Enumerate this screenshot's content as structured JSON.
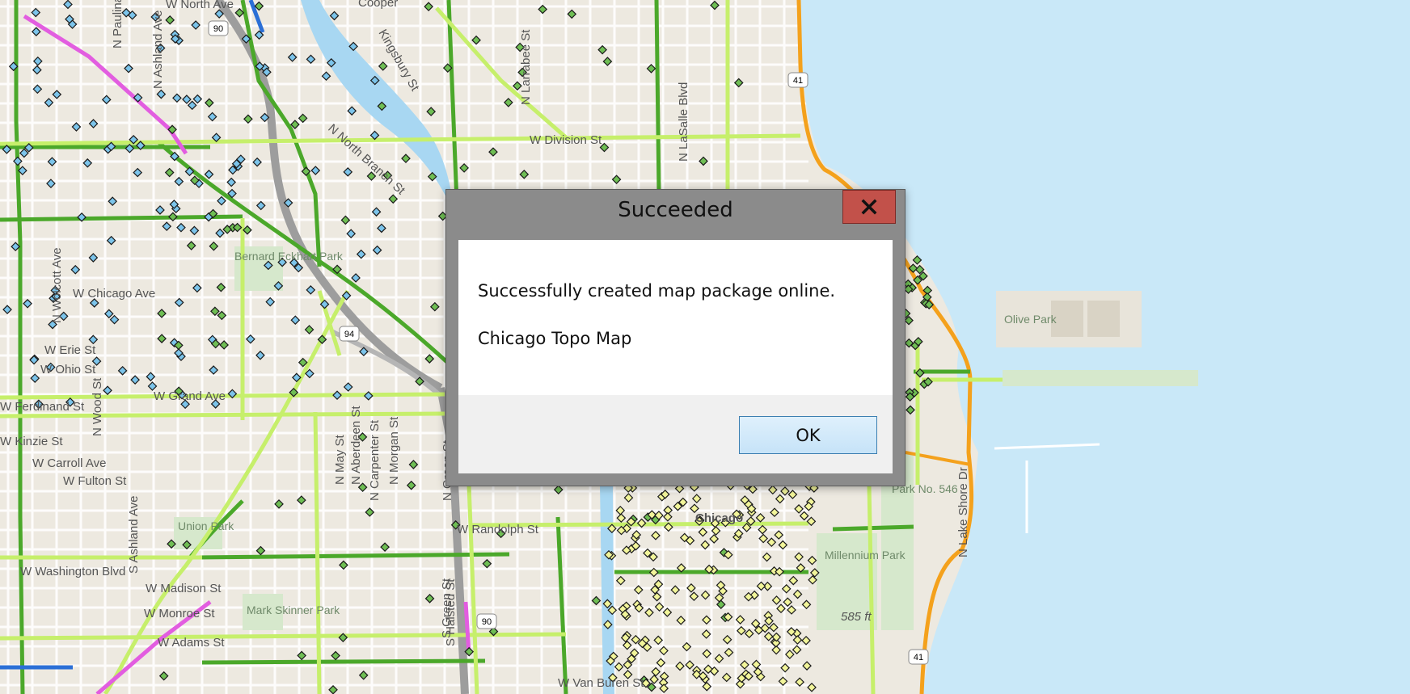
{
  "map": {
    "street_labels": [
      "W North Ave",
      "N Paulina St",
      "N Ashland Ave",
      "Kingsbury St",
      "N Larrabee St",
      "N LaSalle Blvd",
      "W Division St",
      "N North Branch St",
      "W Chicago Ave",
      "N Wolcott Ave",
      "W Erie St",
      "W Ohio St",
      "W Grand Ave",
      "W Ferdinand St",
      "W Kinzie St",
      "W Carroll Ave",
      "W Fulton St",
      "N Wood St",
      "N May St",
      "N Aberdeen St",
      "N Carpenter St",
      "N Morgan St",
      "N Green St",
      "W Randolph St",
      "W Washington Blvd",
      "W Madison St",
      "W Monroe St",
      "W Adams St",
      "W Van Buren St",
      "S Ashland Ave",
      "S Halsted St",
      "N Lake Shore Dr",
      "S Green St"
    ],
    "place_labels": [
      "Bernard Eckhart Park",
      "Union Park",
      "Mark Skinner Park",
      "Olive Park",
      "Millennium Park",
      "Park No. 546",
      "Chicago",
      "Cooper"
    ],
    "highway_shields": [
      "90",
      "94",
      "41",
      "90",
      "41"
    ],
    "elevation_label": "585 ft"
  },
  "dialog": {
    "title": "Succeeded",
    "close_label": "×",
    "message": "Successfully created map package online.",
    "item_name": "Chicago Topo Map",
    "ok_label": "OK"
  },
  "colors": {
    "water": "#c9e8f8",
    "land": "#ede9e0",
    "bike_route_dark": "#4ba82a",
    "bike_route_light": "#c6ef6b",
    "lake_shore_trail": "#f4a11c",
    "pink_route": "#e25de0",
    "blue_route": "#2b6fd6",
    "stop_blue": "#7cc4ea",
    "stop_green": "#6fbe54",
    "stop_yellow": "#f2f59a",
    "dialog_close": "#c2514a",
    "ok_button_border": "#3c7fb1"
  }
}
